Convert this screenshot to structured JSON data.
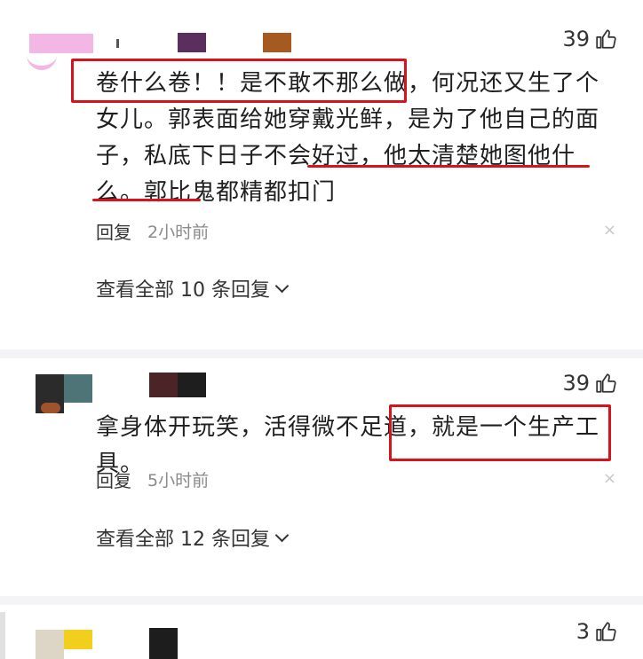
{
  "comments": [
    {
      "likes": "39",
      "text": "卷什么卷！！是不敢不那么做，何况还又生了个女儿。郭表面给她穿戴光鲜，是为了他自己的面子，私底下日子不会好过，他太清楚她图他什么。郭比鬼都精都扣门",
      "reply_label": "回复",
      "time": "2小时前",
      "more_replies": "查看全部 10 条回复",
      "close": "×"
    },
    {
      "likes": "39",
      "text": "拿身体开玩笑，活得微不足道，就是一个生产工具。",
      "reply_label": "回复",
      "time": "5小时前",
      "more_replies": "查看全部 12 条回复",
      "close": "×"
    },
    {
      "likes": "3"
    }
  ],
  "colors": {
    "highlight": "#d7141b",
    "muted": "#8a8a8a"
  }
}
